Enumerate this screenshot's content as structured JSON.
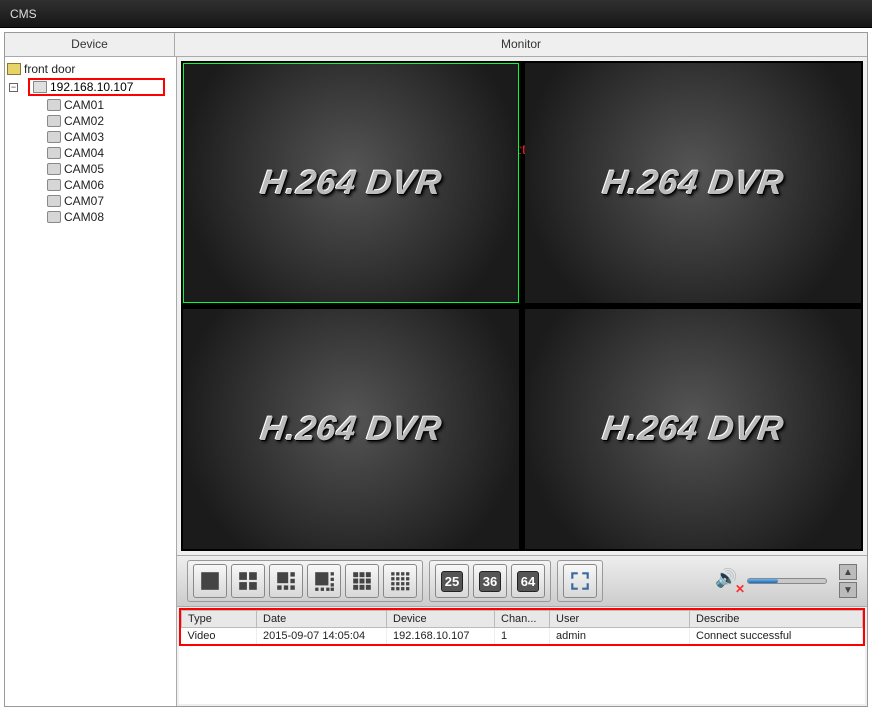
{
  "app_title": "CMS",
  "tabs": {
    "device": "Device",
    "monitor": "Monitor"
  },
  "tree": {
    "root": "front door",
    "ip": "192.168.10.107",
    "cams": [
      "CAM01",
      "CAM02",
      "CAM03",
      "CAM04",
      "CAM05",
      "CAM06",
      "CAM07",
      "CAM08"
    ]
  },
  "annotation": "double click IP to connect DVR",
  "watermark": "H.264 DVR",
  "layout_numbers": [
    "25",
    "36",
    "64"
  ],
  "log": {
    "headers": {
      "type": "Type",
      "date": "Date",
      "device": "Device",
      "channel": "Chan...",
      "user": "User",
      "describe": "Describe"
    },
    "row": {
      "type": "Video",
      "date": "2015-09-07 14:05:04",
      "device": "192.168.10.107",
      "channel": "1",
      "user": "admin",
      "describe": "Connect successful"
    }
  }
}
